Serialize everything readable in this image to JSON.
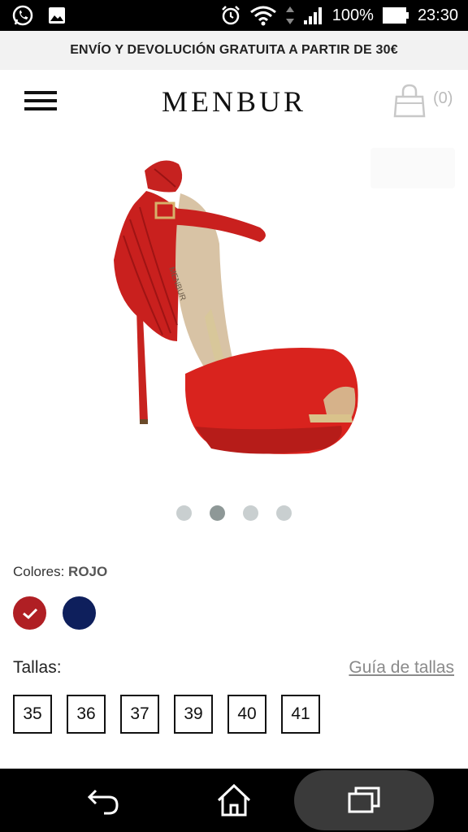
{
  "status_bar": {
    "battery_percent": "100%",
    "time": "23:30",
    "icons": [
      "whatsapp-icon",
      "gallery-icon",
      "alarm-icon",
      "wifi-icon",
      "signal-icon",
      "battery-icon"
    ]
  },
  "promo": {
    "text": "ENVÍO Y DEVOLUCIÓN GRATUITA A PARTIR DE 30€"
  },
  "header": {
    "logo": "MENBUR",
    "cart_count": "(0)",
    "icons": [
      "menu-icon",
      "shopping-bag-icon"
    ]
  },
  "product": {
    "image_subject": "red high-heel peep-toe sandal with ankle strap",
    "gallery": {
      "total": 4,
      "active_index": 1
    }
  },
  "colors": {
    "label": "Colores:",
    "selected": "ROJO",
    "swatches": [
      {
        "color": "#b01f24",
        "selected": true
      },
      {
        "color": "#0e1f5c",
        "selected": false
      }
    ]
  },
  "sizes": {
    "label": "Tallas:",
    "guide_link": "Guía de tallas",
    "options": [
      "35",
      "36",
      "37",
      "39",
      "40",
      "41"
    ]
  },
  "nav_bar": {
    "icons": [
      "back-icon",
      "home-icon",
      "recents-icon"
    ]
  },
  "theme": {
    "accent": "#b01f24",
    "link": "#8a8a8a",
    "promo_bg": "#f2f2f2"
  }
}
